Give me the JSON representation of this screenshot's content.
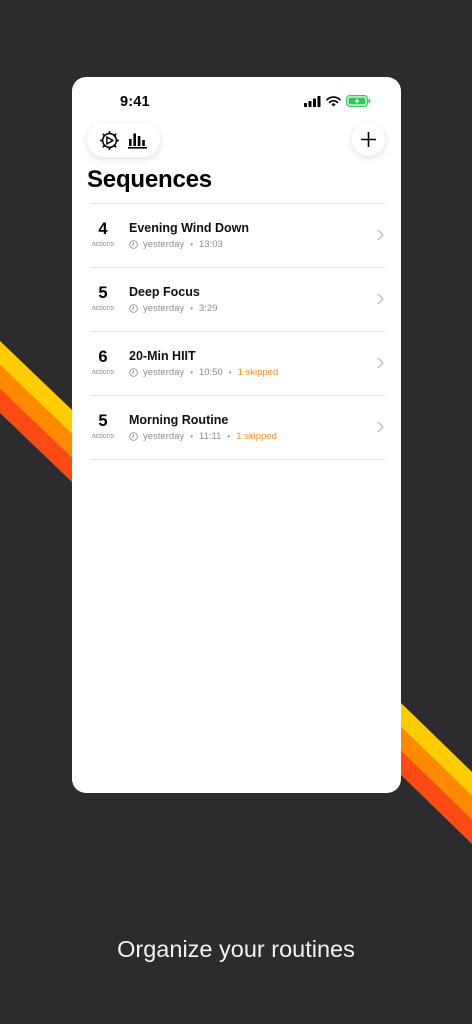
{
  "status_bar": {
    "time": "9:41"
  },
  "header": {
    "title": "Sequences"
  },
  "toolbar": {
    "left_icons": [
      "gear-icon",
      "bar-chart-icon"
    ],
    "right_icon": "plus-icon"
  },
  "sequences": [
    {
      "count": "4",
      "count_label": "actions",
      "title": "Evening Wind Down",
      "day": "yesterday",
      "time": "13:03",
      "skipped": ""
    },
    {
      "count": "5",
      "count_label": "actions",
      "title": "Deep Focus",
      "day": "yesterday",
      "time": "3:29",
      "skipped": ""
    },
    {
      "count": "6",
      "count_label": "actions",
      "title": "20-Min HIIT",
      "day": "yesterday",
      "time": "10:50",
      "skipped": "1 skipped"
    },
    {
      "count": "5",
      "count_label": "actions",
      "title": "Morning Routine",
      "day": "yesterday",
      "time": "11:11",
      "skipped": "1 skipped"
    }
  ],
  "caption": "Organize your routines",
  "colors": {
    "background": "#2c2c2e",
    "stripe_yellow": "#ffcc00",
    "stripe_orange": "#ff8a00",
    "stripe_red": "#ff4a14",
    "skipped": "#f0921e",
    "battery": "#34c759"
  }
}
